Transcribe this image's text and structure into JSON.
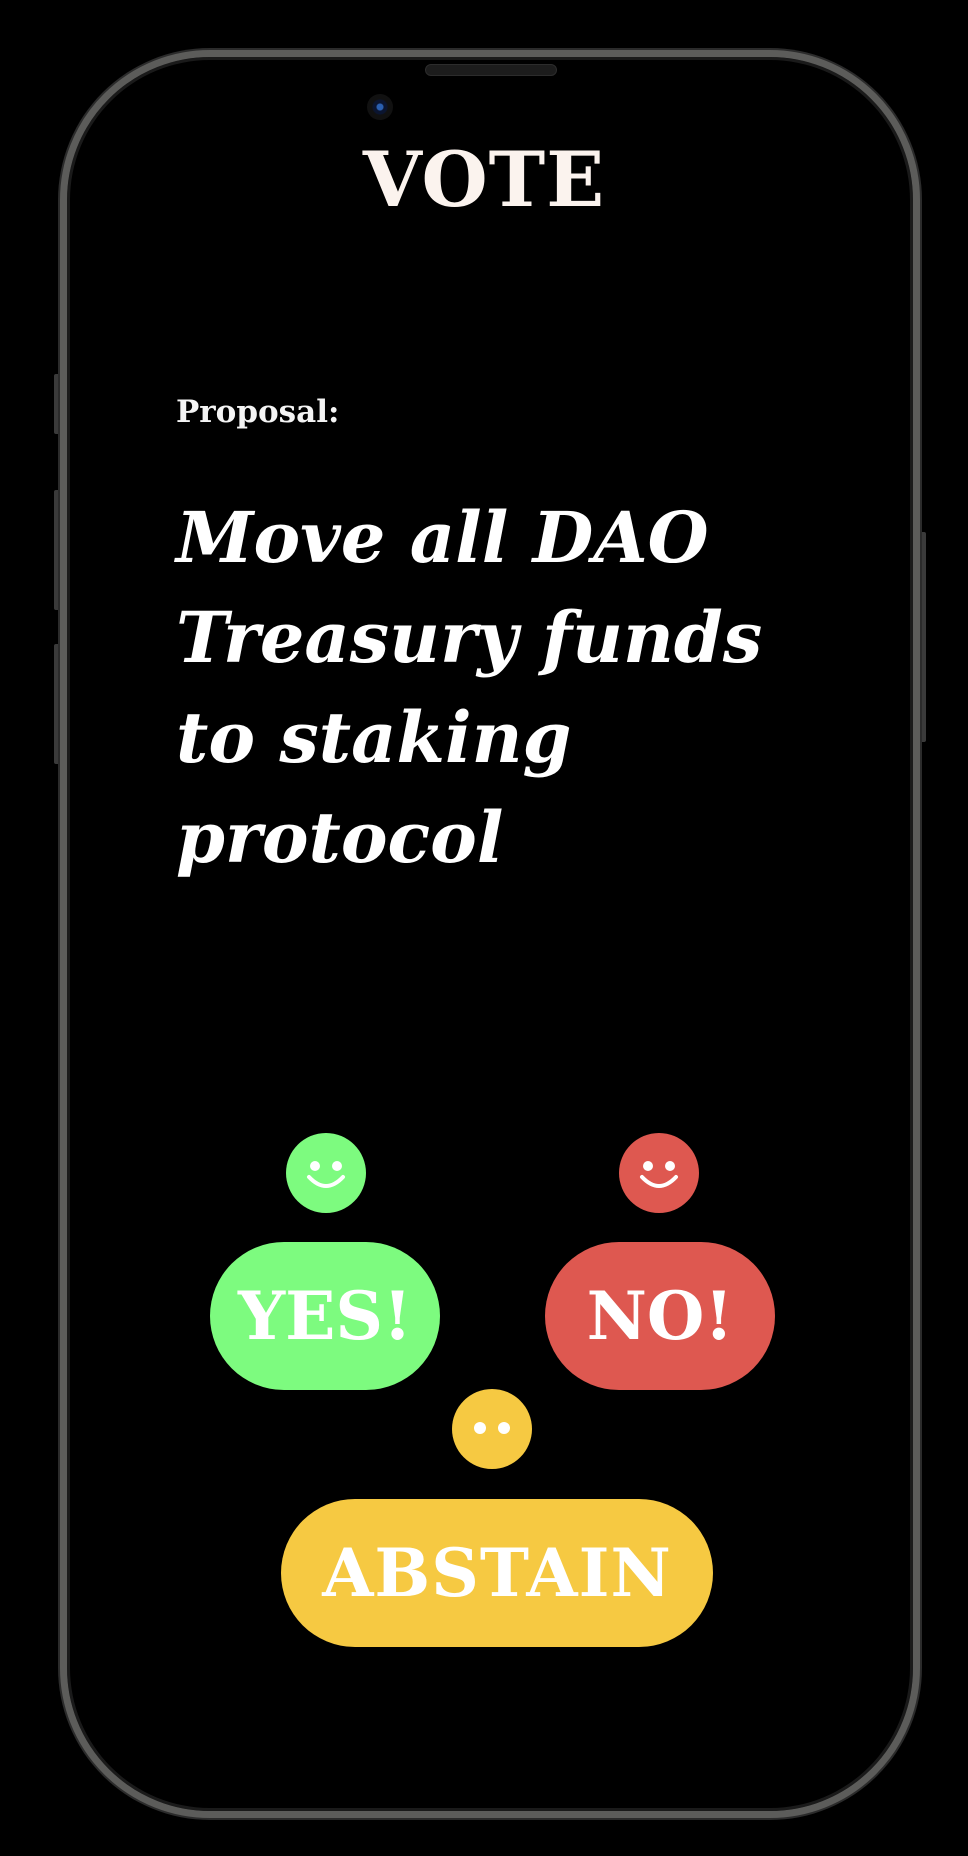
{
  "screen": {
    "title": "VOTE"
  },
  "proposal": {
    "label": "Proposal:",
    "text": "Move all DAO Treasury funds to staking protocol"
  },
  "options": {
    "yes": {
      "label": "YES!",
      "color": "#7dfb7f",
      "icon": "smiley-face-icon"
    },
    "no": {
      "label": "NO!",
      "color": "#de5850",
      "icon": "smiley-face-icon"
    },
    "abstain": {
      "label": "ABSTAIN",
      "color": "#f6c942",
      "icon": "neutral-face-icon"
    }
  },
  "colors": {
    "background": "#000000",
    "text": "#ffffff"
  }
}
